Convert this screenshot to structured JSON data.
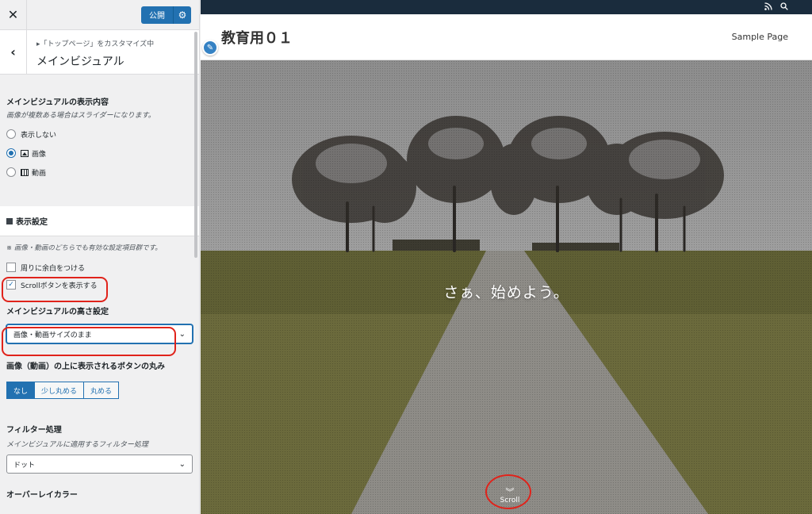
{
  "customizer": {
    "close_icon": "close-icon",
    "publish_label": "公開",
    "breadcrumb": "「トップページ」をカスタマイズ中",
    "section_title": "メインビジュアル",
    "display_content": {
      "title": "メインビジュアルの表示内容",
      "desc": "画像が複数ある場合はスライダーになります。",
      "options": [
        "表示しない",
        "画像",
        "動画"
      ],
      "selected": "画像"
    },
    "display_settings": {
      "title": "表示設定",
      "desc": "※ 画像・動画のどちらでも有効な設定項目群です。",
      "margin_label": "周りに余白をつける",
      "margin_checked": false,
      "scroll_label": "Scrollボタンを表示する",
      "scroll_checked": true
    },
    "height_setting": {
      "title": "メインビジュアルの高さ設定",
      "value": "画像・動画サイズのまま"
    },
    "button_round": {
      "title": "画像（動画）の上に表示されるボタンの丸み",
      "options": [
        "なし",
        "少し丸める",
        "丸める"
      ],
      "selected": "なし"
    },
    "filter": {
      "title": "フィルター処理",
      "desc": "メインビジュアルに適用するフィルター処理",
      "value": "ドット"
    },
    "overlay": {
      "title": "オーバーレイカラー"
    }
  },
  "preview": {
    "site_title": "教育用０１",
    "nav_item": "Sample Page",
    "hero_caption": "さぁ、始めよう。",
    "scroll_label": "Scroll"
  },
  "colors": {
    "accent": "#2271b1",
    "highlight_ring": "#e0231b",
    "utility_bar": "#1a2c3d"
  }
}
